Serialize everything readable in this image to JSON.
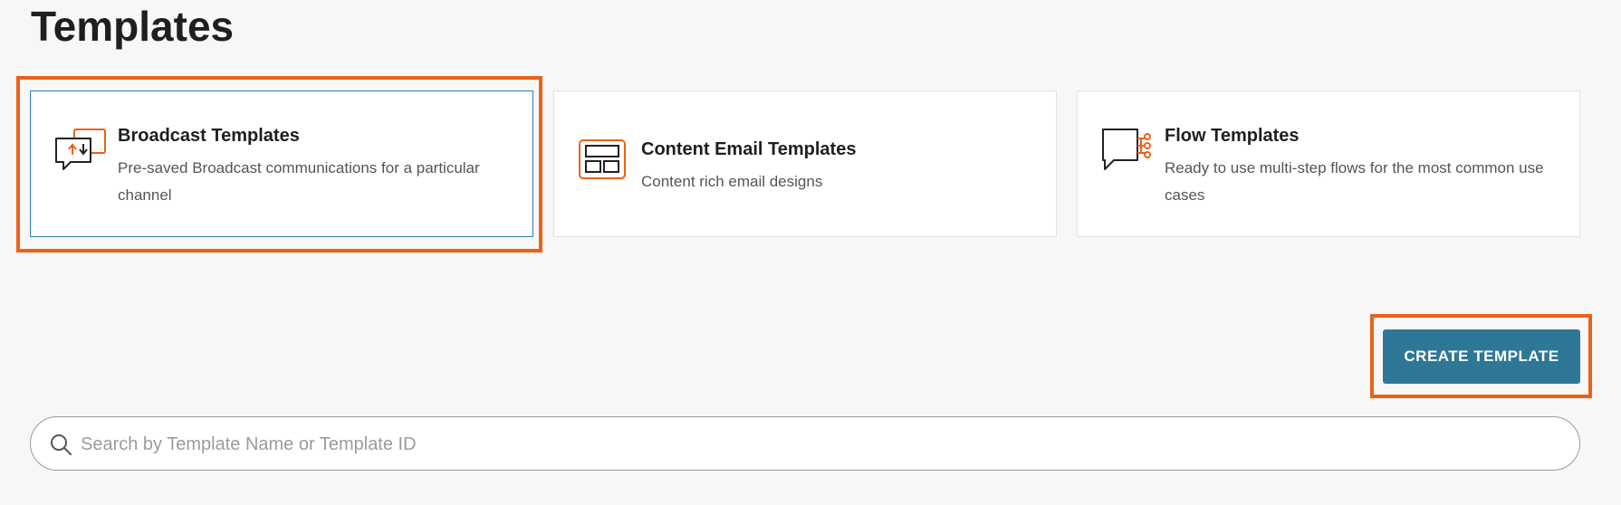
{
  "page": {
    "title": "Templates"
  },
  "cards": [
    {
      "title": "Broadcast Templates",
      "description": "Pre-saved Broadcast communications for a particular channel",
      "icon": "broadcast-icon",
      "selected": true
    },
    {
      "title": "Content Email Templates",
      "description": "Content rich email designs",
      "icon": "email-layout-icon",
      "selected": false
    },
    {
      "title": "Flow Templates",
      "description": "Ready to use multi-step flows for the most common use cases",
      "icon": "flow-icon",
      "selected": false
    }
  ],
  "actions": {
    "create_template_label": "CREATE TEMPLATE"
  },
  "search": {
    "placeholder": "Search by Template Name or Template ID",
    "value": "",
    "icon": "search-icon"
  },
  "colors": {
    "accent_orange": "#ec6119",
    "button_blue": "#2e7796",
    "selected_border": "#2f7fb0",
    "background": "#f7f7f7"
  }
}
